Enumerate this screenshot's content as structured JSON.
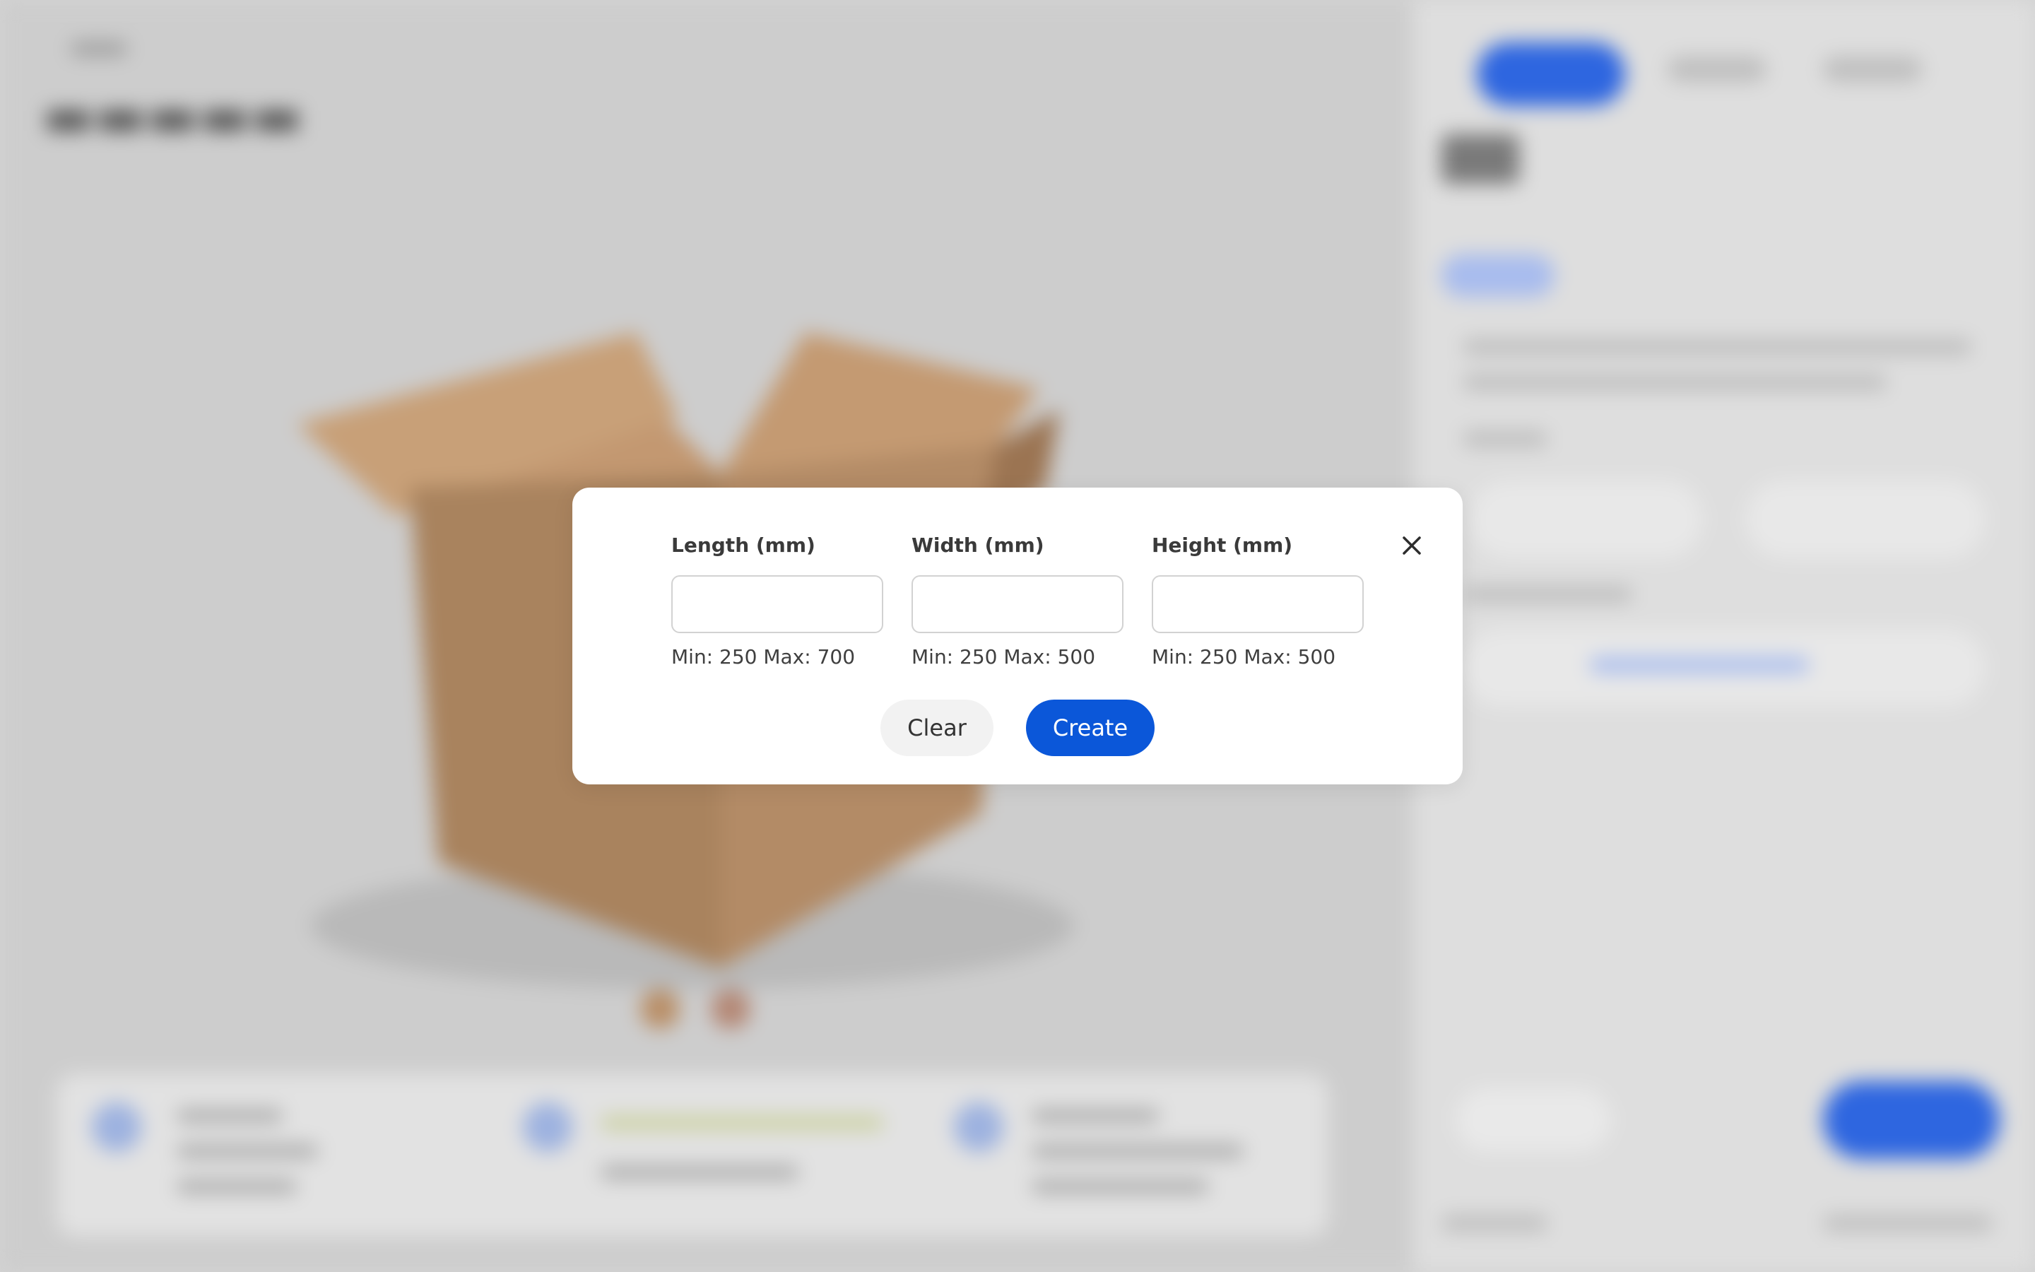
{
  "modal": {
    "fields": [
      {
        "label": "Length (mm)",
        "value": "",
        "hint": "Min: 250 Max: 700"
      },
      {
        "label": "Width (mm)",
        "value": "",
        "hint": "Min: 250 Max: 500"
      },
      {
        "label": "Height (mm)",
        "value": "",
        "hint": "Min: 250 Max: 500"
      }
    ],
    "clear_label": "Clear",
    "create_label": "Create",
    "close_icon": "close-icon"
  },
  "colors": {
    "primary": "#0b57d9",
    "secondary_button": "#f2f2f2",
    "overlay": "#d3d3d3",
    "modal_background": "#ffffff"
  }
}
